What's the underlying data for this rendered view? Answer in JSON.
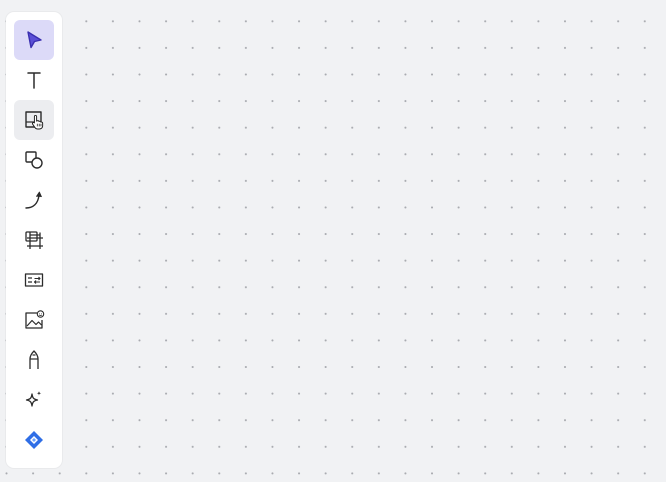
{
  "toolbar": {
    "items": [
      {
        "id": "select",
        "icon": "pointer-icon",
        "state": "active"
      },
      {
        "id": "text",
        "icon": "text-icon",
        "state": "normal"
      },
      {
        "id": "sticky-note",
        "icon": "sticky-note-icon",
        "state": "hovered"
      },
      {
        "id": "shapes",
        "icon": "shapes-icon",
        "state": "normal"
      },
      {
        "id": "connector",
        "icon": "connector-arrow-icon",
        "state": "normal"
      },
      {
        "id": "frame",
        "icon": "frame-icon",
        "state": "normal"
      },
      {
        "id": "card",
        "icon": "card-icon",
        "state": "normal"
      },
      {
        "id": "image",
        "icon": "image-icon",
        "state": "normal"
      },
      {
        "id": "pen",
        "icon": "pen-icon",
        "state": "normal"
      },
      {
        "id": "ai",
        "icon": "sparkle-icon",
        "state": "normal"
      },
      {
        "id": "jira",
        "icon": "jira-icon",
        "state": "normal"
      }
    ]
  },
  "colors": {
    "canvas": "#f1f2f4",
    "active_tool_bg": "#dcdaf8",
    "active_icon": "#5b4fd6",
    "jira_blue": "#2f6ee6"
  }
}
